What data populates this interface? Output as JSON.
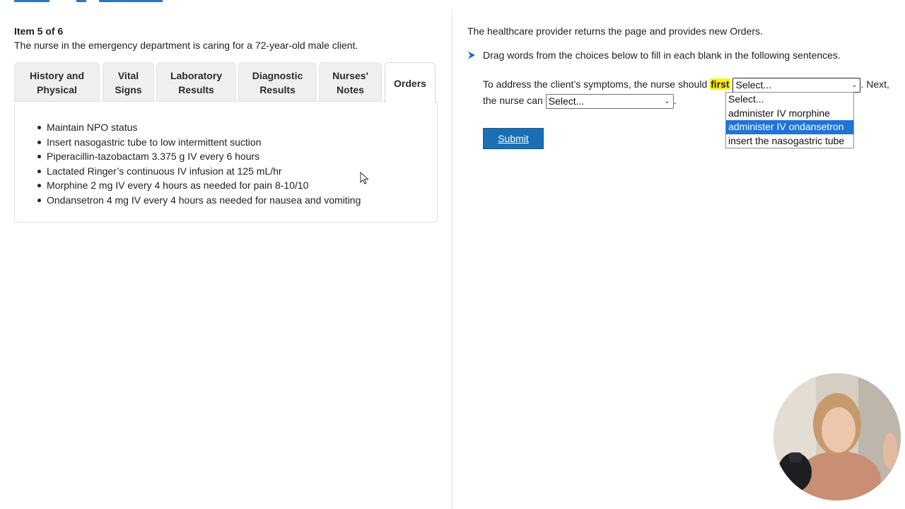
{
  "item": {
    "title": "Item 5 of 6",
    "stem": "The nurse in the emergency department is caring for a 72-year-old male client."
  },
  "tabs": [
    {
      "label": "History and Physical",
      "active": false
    },
    {
      "label": "Vital Signs",
      "active": false
    },
    {
      "label": "Laboratory Results",
      "active": false
    },
    {
      "label": "Diagnostic Results",
      "active": false
    },
    {
      "label": "Nurses' Notes",
      "active": false
    },
    {
      "label": "Orders",
      "active": true
    }
  ],
  "orders": [
    "Maintain NPO status",
    "Insert nasogastric tube to low intermittent suction",
    "Piperacillin-tazobactam 3.375 g IV every 6 hours",
    "Lactated Ringer’s continuous IV infusion at 125 mL/hr",
    "Morphine 2 mg IV every 4 hours as needed for pain 8-10/10",
    "Ondansetron 4 mg IV every 4 hours as needed for nausea and vomiting"
  ],
  "question": {
    "intro": "The healthcare provider returns the page and provides new Orders.",
    "instruction": "Drag words from the choices below to fill in each blank in the following sentences.",
    "sentence_part1": "To address the client’s symptoms, the nurse should",
    "highlight": "first",
    "sentence_part2": ". Next,",
    "sentence_part3": "the nurse can",
    "sentence_end": "."
  },
  "selects": {
    "first": {
      "value": "Select..."
    },
    "second": {
      "value": "Select..."
    }
  },
  "dropdown_options": [
    "Select...",
    "administer IV morphine",
    "administer IV ondansetron",
    "insert the nasogastric tube"
  ],
  "dropdown_highlighted_index": 2,
  "submit": {
    "label": "Submit"
  },
  "colors": {
    "accent": "#1c6fb3",
    "highlight": "#fff200",
    "option_selected": "#1f73d9"
  }
}
